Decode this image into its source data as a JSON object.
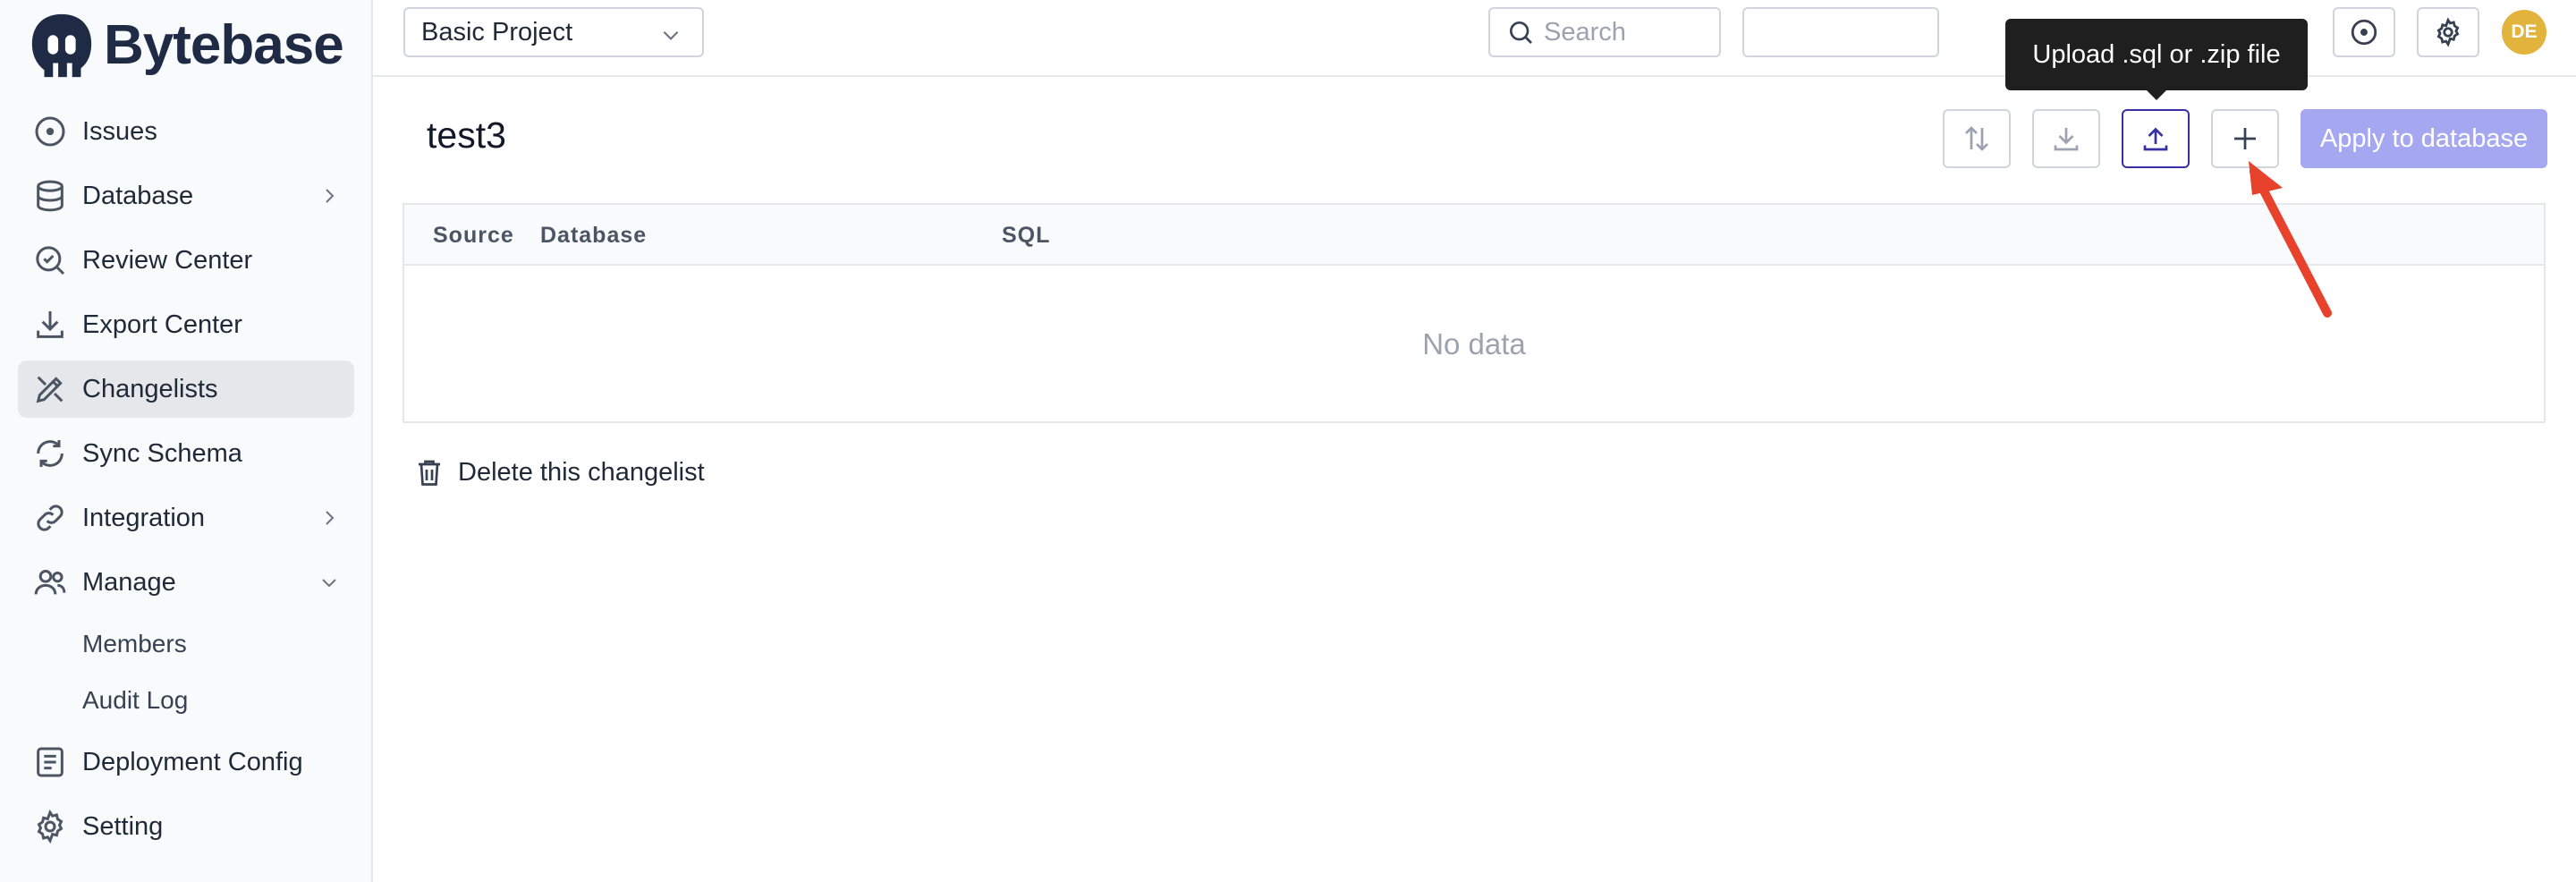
{
  "app": {
    "brand": "Bytebase",
    "project_select": "Basic Project",
    "search_placeholder": "Search",
    "avatar_initials": "DE"
  },
  "sidebar": {
    "items": [
      {
        "label": "Issues",
        "icon": "issues-icon"
      },
      {
        "label": "Database",
        "icon": "database-icon"
      },
      {
        "label": "Review Center",
        "icon": "review-icon"
      },
      {
        "label": "Export Center",
        "icon": "export-icon"
      },
      {
        "label": "Changelists",
        "icon": "changelist-icon",
        "active": true
      },
      {
        "label": "Sync Schema",
        "icon": "sync-icon"
      },
      {
        "label": "Integration",
        "icon": "link-icon"
      },
      {
        "label": "Manage",
        "icon": "users-icon"
      },
      {
        "label": "Deployment Config",
        "icon": "config-icon"
      },
      {
        "label": "Setting",
        "icon": "gear-icon"
      }
    ],
    "manage_sub": [
      "Members",
      "Audit Log"
    ]
  },
  "page": {
    "title": "test3",
    "apply_button": "Apply to database",
    "tooltip": "Upload .sql or .zip file",
    "table": {
      "headers": [
        "Source",
        "Database",
        "SQL"
      ],
      "empty": "No data"
    },
    "delete_link": "Delete this changelist"
  },
  "colors": {
    "accent": "#3730a3",
    "apply_button_bg": "#a5a8f0",
    "avatar_bg": "#e2b33d",
    "annotation_arrow": "#e8412c"
  }
}
